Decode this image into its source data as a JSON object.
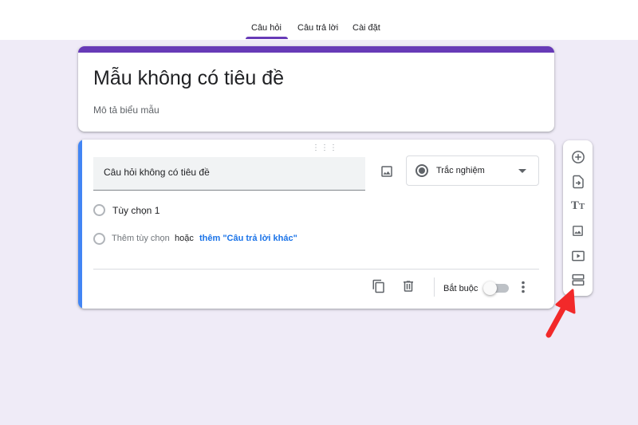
{
  "tabs": [
    {
      "label": "Câu hỏi",
      "active": true
    },
    {
      "label": "Câu trả lời",
      "active": false
    },
    {
      "label": "Cài đặt",
      "active": false
    }
  ],
  "form": {
    "title": "Mẫu không có tiêu đề",
    "description": "Mô tả biểu mẫu"
  },
  "question": {
    "title": "Câu hỏi không có tiêu đề",
    "type": "Trắc nghiệm",
    "options": [
      "Tùy chọn 1"
    ],
    "add_option": "Thêm tùy chọn",
    "or": "hoặc",
    "add_other": "thêm \"Câu trả lời khác\"",
    "required_label": "Bắt buộc",
    "required": false
  },
  "side_toolbar": {
    "tools": [
      "add-question-icon",
      "import-questions-icon",
      "title-description-icon",
      "add-image-icon",
      "add-video-icon",
      "add-section-icon"
    ]
  },
  "colors": {
    "accent": "#673ab7",
    "active_card": "#4285f4",
    "link": "#1a73e8",
    "background": "#efebf7",
    "annotation_arrow": "#f2292a"
  }
}
